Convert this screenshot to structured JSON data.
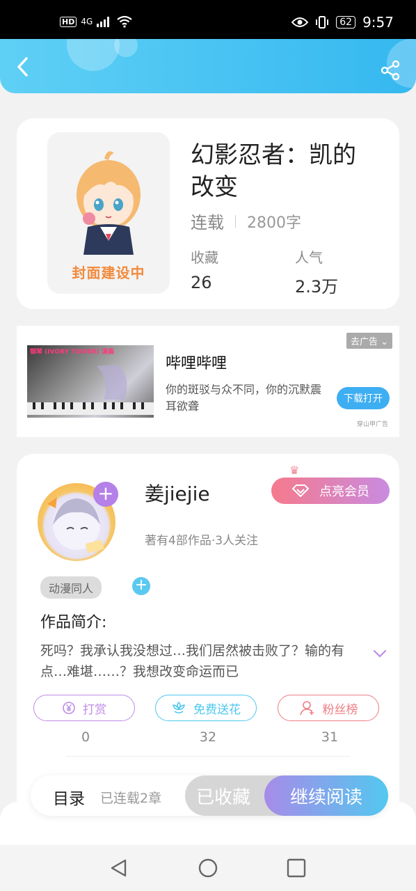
{
  "status_bar": {
    "hd": "HD",
    "network": "4G",
    "battery": "62",
    "time": "9:57"
  },
  "header": {
    "back_icon": "back-arrow-icon",
    "share_icon": "share-icon"
  },
  "book": {
    "cover_text": "封面建设中",
    "title": "幻影忍者：凯的改变",
    "status": "连载",
    "word_count": "2800字",
    "favorites_label": "收藏",
    "favorites_value": "26",
    "popularity_label": "人气",
    "popularity_value": "2.3万"
  },
  "ad": {
    "remove_label": "去广告",
    "thumb_title": "钢琴 (IVORY TOWER) 演奏",
    "title": "哔哩哔哩",
    "description": "你的斑驳与众不同，你的沉默震耳欲聋",
    "download_label": "下载打开",
    "source": "穿山甲广告"
  },
  "author": {
    "name": "姜jiejie",
    "vip_label": "点亮会员",
    "info": "著有4部作品·3人关注",
    "tag": "动漫同人",
    "intro_label": "作品简介:",
    "intro_text": "死吗？我承认我没想过…我们居然被击败了？输的有点…难堪……？我想改变命运而已"
  },
  "actions": [
    {
      "label": "打赏",
      "count": "0",
      "color": "#c08be6",
      "icon": "yen-icon"
    },
    {
      "label": "免费送花",
      "count": "32",
      "color": "#4cc8ee",
      "icon": "flower-icon"
    },
    {
      "label": "粉丝榜",
      "count": "31",
      "color": "#ef7d83",
      "icon": "fans-icon"
    }
  ],
  "bottom_bar": {
    "toc_label": "目录",
    "chapters": "已连载2章",
    "collected_label": "已收藏",
    "read_label": "继续阅读"
  }
}
